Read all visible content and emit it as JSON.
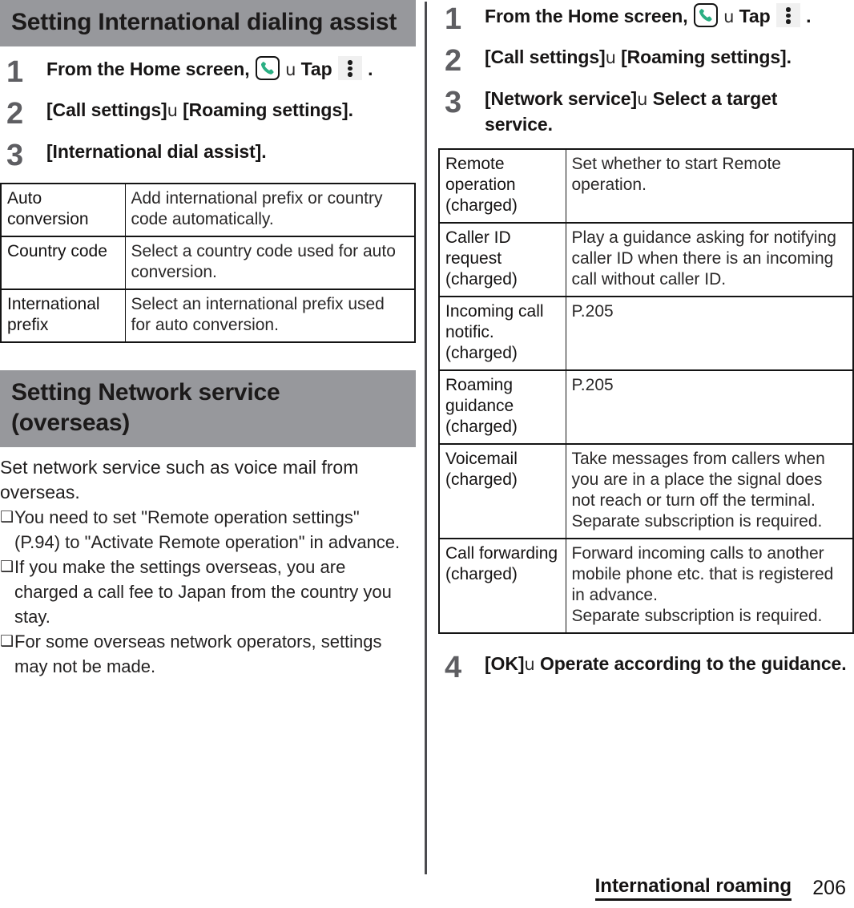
{
  "document": {
    "footer": {
      "chapter_title": "International roaming",
      "page_number": "206"
    }
  },
  "icons": {
    "phone": "phone-icon",
    "overflow_menu": "three-dot-menu-icon",
    "arrow": "u",
    "note_bullet": "❑"
  },
  "colors": {
    "header_band": "#97989c",
    "step_number": "#5e5e62",
    "text": "#211f1f",
    "rule": "#141414",
    "phone_icon_green": "#2aaf83"
  },
  "left_column": {
    "section": {
      "title": "Setting International dialing assist"
    },
    "steps": [
      {
        "num": "1",
        "pre": "From the Home screen,",
        "has_phone_icon": true,
        "mid": "Tap",
        "has_menu_icon": true,
        "post": "."
      },
      {
        "num": "2",
        "text_a": "[Call settings]",
        "arrow": "u",
        "text_b": "[Roaming settings]."
      },
      {
        "num": "3",
        "text_a": "[International dial assist]."
      }
    ],
    "table": {
      "rows": [
        {
          "term": "Auto conversion",
          "desc": "Add international prefix or country code automatically."
        },
        {
          "term": "Country code",
          "desc": "Select a country code used for auto conversion."
        },
        {
          "term": "International prefix",
          "desc": "Select an international prefix used for auto conversion."
        }
      ]
    },
    "section2": {
      "title": "Setting Network service (overseas)",
      "intro": "Set network service such as voice mail from overseas.",
      "notes": [
        "You need to set \"Remote operation settings\" (P.94) to \"Activate Remote operation\" in advance.",
        "If you make the settings overseas, you are charged a call fee to Japan from the country you stay.",
        "For some overseas network operators, settings may not be made."
      ]
    }
  },
  "right_column": {
    "steps": [
      {
        "num": "1",
        "pre": "From the Home screen,",
        "has_phone_icon": true,
        "mid": "Tap",
        "has_menu_icon": true,
        "post": "."
      },
      {
        "num": "2",
        "text_a": "[Call settings]",
        "arrow": "u",
        "text_b": "[Roaming settings]."
      },
      {
        "num": "3",
        "text_a": "[Network service]",
        "arrow": "u",
        "text_b": "Select a target service."
      },
      {
        "num": "4",
        "text_a": "[OK]",
        "arrow": "u",
        "text_b": "Operate according to the guidance."
      }
    ],
    "table": {
      "rows": [
        {
          "term": "Remote operation (charged)",
          "desc": "Set whether to start Remote operation."
        },
        {
          "term": "Caller ID request (charged)",
          "desc": "Play a guidance asking for notifying caller ID when there is an incoming call without caller ID."
        },
        {
          "term": "Incoming call notific. (charged)",
          "desc": "P.205"
        },
        {
          "term": "Roaming guidance (charged)",
          "desc": "P.205"
        },
        {
          "term": "Voicemail (charged)",
          "desc": "Take messages from callers when you are in a place the signal does not reach or turn off the terminal.\nSeparate subscription is required."
        },
        {
          "term": "Call forwarding (charged)",
          "desc": "Forward incoming calls to another mobile phone etc. that is registered in advance.\nSeparate subscription is required."
        }
      ]
    }
  }
}
